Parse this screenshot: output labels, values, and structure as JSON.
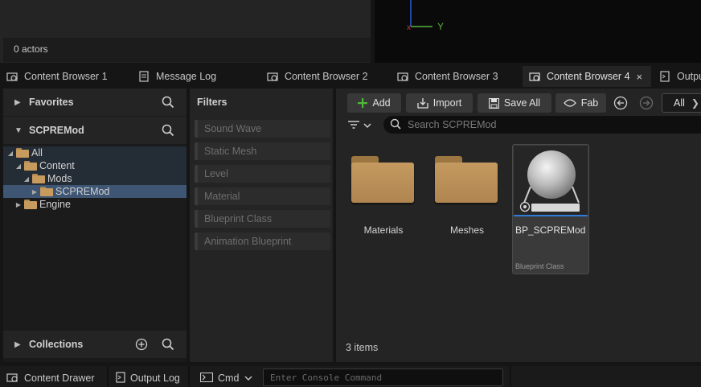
{
  "outliner": {
    "actor_count": "0 actors"
  },
  "viewport": {
    "axis_y_label": "Y"
  },
  "tabs": [
    {
      "label": "Content Browser 1",
      "icon": "content-browser-icon"
    },
    {
      "label": "Message Log",
      "icon": "message-log-icon"
    },
    {
      "label": "Content Browser 2",
      "icon": "content-browser-icon"
    },
    {
      "label": "Content Browser 3",
      "icon": "content-browser-icon"
    },
    {
      "label": "Content Browser 4",
      "icon": "content-browser-icon",
      "active": true,
      "close": "×"
    },
    {
      "label": "Outpu",
      "icon": "output-log-icon"
    }
  ],
  "sources": {
    "favorites_label": "Favorites",
    "project_label": "SCPREMod",
    "collections_label": "Collections",
    "tree": [
      {
        "label": "All",
        "depth": 0,
        "expanded": true
      },
      {
        "label": "Content",
        "depth": 1,
        "expanded": true
      },
      {
        "label": "Mods",
        "depth": 2,
        "expanded": true
      },
      {
        "label": "SCPREMod",
        "depth": 3,
        "expanded": false,
        "selected": true
      },
      {
        "label": "Engine",
        "depth": 1,
        "expanded": false
      }
    ]
  },
  "filters": {
    "title": "Filters",
    "items": [
      "Sound Wave",
      "Static Mesh",
      "Level",
      "Material",
      "Blueprint Class",
      "Animation Blueprint"
    ]
  },
  "toolbar": {
    "add_label": "Add",
    "import_label": "Import",
    "save_all_label": "Save All",
    "fab_label": "Fab",
    "all_label": "All"
  },
  "search": {
    "placeholder": "Search SCPREMod"
  },
  "assets": [
    {
      "name": "Materials",
      "kind": "folder"
    },
    {
      "name": "Meshes",
      "kind": "folder"
    },
    {
      "name": "BP_SCPREMod",
      "kind": "blueprint",
      "type_label": "Blueprint Class"
    }
  ],
  "status": {
    "items_count": "3 items"
  },
  "bottom_bar": {
    "content_drawer_label": "Content Drawer",
    "output_log_label": "Output Log",
    "cmd_label": "Cmd",
    "console_placeholder": "Enter Console Command"
  },
  "colors": {
    "accent_blue": "#2f7bd8",
    "folder_tan": "#c49a60",
    "add_green": "#4fba3a"
  }
}
